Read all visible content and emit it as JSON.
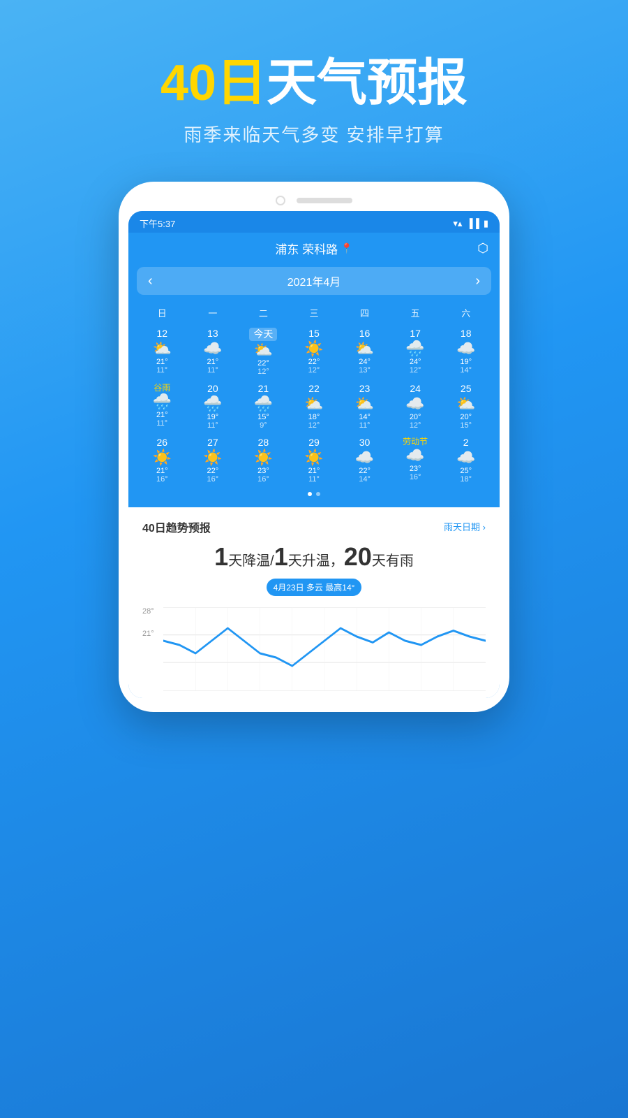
{
  "hero": {
    "title_yellow": "40日",
    "title_white": "天气预报",
    "subtitle": "雨季来临天气多变 安排早打算"
  },
  "statusBar": {
    "time": "下午5:37",
    "icons": [
      "▲▲",
      "📶",
      "🔋"
    ]
  },
  "location": {
    "name": "浦东 荣科路",
    "pin": "📍"
  },
  "monthNav": {
    "prev": "‹",
    "title": "2021年4月",
    "next": "›"
  },
  "weekdays": [
    "日",
    "一",
    "二",
    "三",
    "四",
    "五",
    "六"
  ],
  "calendar": {
    "rows": [
      [
        {
          "day": "12",
          "icon": "☁",
          "high": "21°",
          "low": "11°"
        },
        {
          "day": "13",
          "icon": "☁",
          "high": "21°",
          "low": "11°"
        },
        {
          "day": "今天",
          "today": true,
          "icon": "⛅",
          "high": "22°",
          "low": "12°"
        },
        {
          "day": "15",
          "icon": "☀",
          "high": "22°",
          "low": "12°"
        },
        {
          "day": "16",
          "icon": "⛅",
          "high": "24°",
          "low": "13°"
        },
        {
          "day": "17",
          "icon": "🌧",
          "high": "24°",
          "low": "12°"
        },
        {
          "day": "18",
          "icon": "☁",
          "high": "19°",
          "low": "14°"
        }
      ],
      [
        {
          "day": "谷雨",
          "special": true,
          "icon": "🌧",
          "high": "21°",
          "low": "11°"
        },
        {
          "day": "20",
          "icon": "🌧",
          "high": "19°",
          "low": "11°"
        },
        {
          "day": "21",
          "icon": "🌧",
          "high": "15°",
          "low": "9°"
        },
        {
          "day": "22",
          "icon": "⛅",
          "high": "18°",
          "low": "12°"
        },
        {
          "day": "23",
          "icon": "⛅",
          "high": "14°",
          "low": "11°"
        },
        {
          "day": "24",
          "icon": "☁",
          "high": "20°",
          "low": "12°"
        },
        {
          "day": "25",
          "icon": "⛅",
          "high": "20°",
          "low": "15°"
        }
      ],
      [
        {
          "day": "26",
          "icon": "☀",
          "high": "21°",
          "low": "16°"
        },
        {
          "day": "27",
          "icon": "☀",
          "high": "22°",
          "low": "16°"
        },
        {
          "day": "28",
          "icon": "☀",
          "high": "23°",
          "low": "16°"
        },
        {
          "day": "29",
          "icon": "☀",
          "high": "21°",
          "low": "11°"
        },
        {
          "day": "30",
          "icon": "☁",
          "high": "22°",
          "low": "14°"
        },
        {
          "day": "劳动节",
          "special": true,
          "icon": "☁",
          "high": "23°",
          "low": "16°"
        },
        {
          "day": "2",
          "icon": "☁",
          "high": "25°",
          "low": "18°"
        }
      ]
    ]
  },
  "forecast40": {
    "title": "40日趋势预报",
    "link": "雨天日期 ›",
    "stats": "天降温/",
    "stat1": "1",
    "stat2": "1",
    "stat3": "20",
    "statsText": "天升温，",
    "statsEnd": "天有雨",
    "badge": "4月23日 多云 最高14°",
    "chartLabels": [
      "28°",
      "21°"
    ],
    "chartData": [
      22,
      21,
      20,
      22,
      24,
      22,
      20,
      19,
      18,
      20,
      22,
      24,
      22,
      21,
      23,
      22,
      21,
      23,
      24,
      22
    ]
  }
}
